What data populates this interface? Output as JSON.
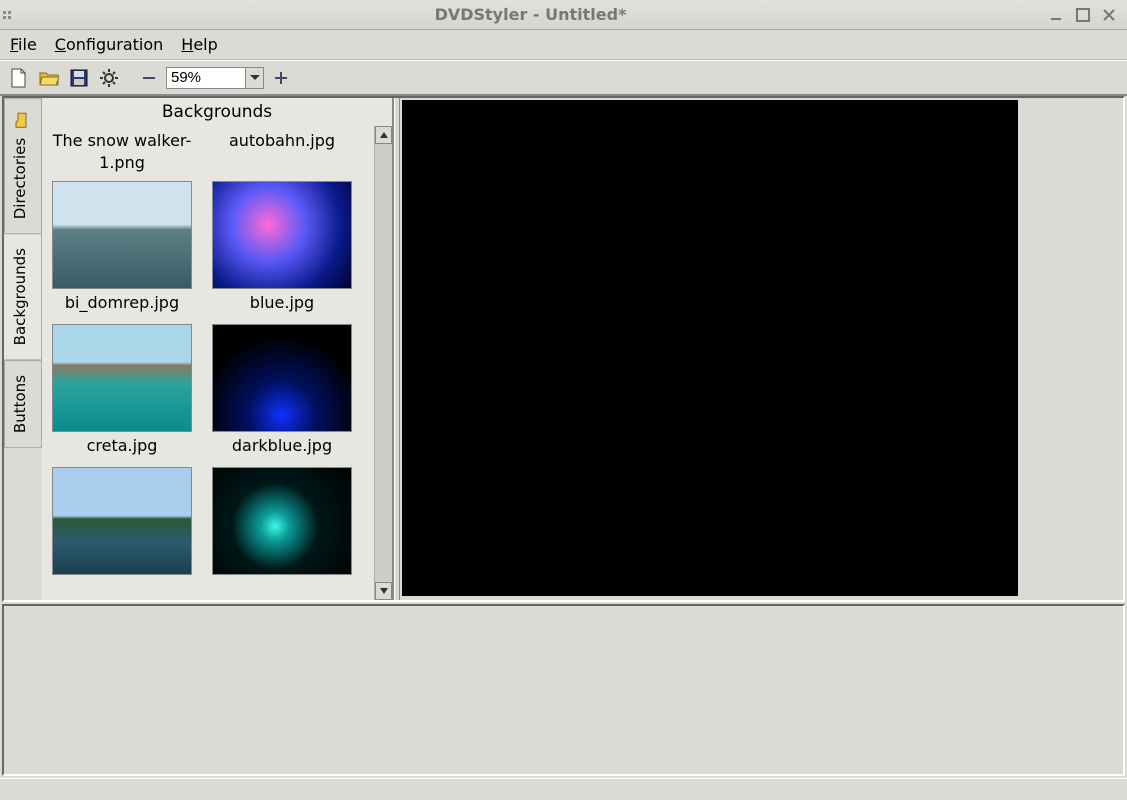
{
  "window": {
    "title": "DVDStyler - Untitled*"
  },
  "menu": {
    "file": "File",
    "config": "Configuration",
    "help": "Help"
  },
  "toolbar": {
    "zoom_value": "59%"
  },
  "sidetabs": {
    "directories": "Directories",
    "backgrounds": "Backgrounds",
    "buttons": "Buttons"
  },
  "browser": {
    "title": "Backgrounds",
    "items": [
      {
        "label": "The snow walker-1.png"
      },
      {
        "label": "autobahn.jpg"
      },
      {
        "label": "bi_domrep.jpg"
      },
      {
        "label": "blue.jpg"
      },
      {
        "label": "creta.jpg"
      },
      {
        "label": "darkblue.jpg"
      },
      {
        "label": ""
      },
      {
        "label": ""
      }
    ]
  }
}
